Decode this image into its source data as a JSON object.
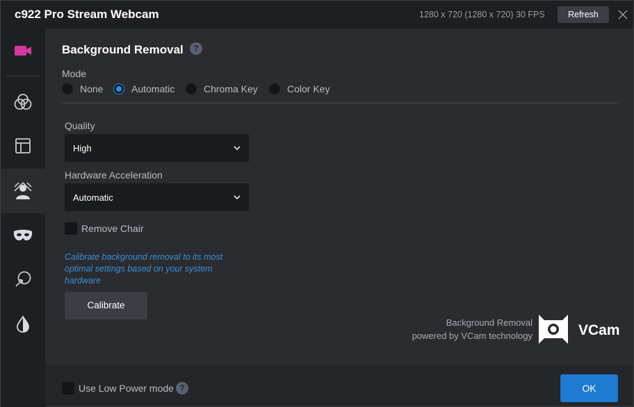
{
  "window": {
    "title": "c922 Pro Stream Webcam",
    "resolution_info": "1280 x 720 (1280 x 720) 30 FPS",
    "refresh_label": "Refresh"
  },
  "sidebar": {
    "items": [
      {
        "icon": "video-camera-icon",
        "color": "#d63aa0"
      },
      {
        "icon": "color-circles-icon"
      },
      {
        "icon": "layout-icon"
      },
      {
        "icon": "background-removal-icon",
        "active": true
      },
      {
        "icon": "mask-icon"
      },
      {
        "icon": "link-icon"
      },
      {
        "icon": "contrast-drop-icon"
      }
    ]
  },
  "main": {
    "section_title": "Background Removal",
    "mode_label": "Mode",
    "mode_options": [
      "None",
      "Automatic",
      "Chroma Key",
      "Color Key"
    ],
    "mode_selected": "Automatic",
    "quality_label": "Quality",
    "quality_value": "High",
    "hw_label": "Hardware Acceleration",
    "hw_value": "Automatic",
    "remove_chair_label": "Remove Chair",
    "calibrate_hint": "Calibrate background removal to its most optimal settings based on your system hardware",
    "calibrate_label": "Calibrate",
    "powered_line1": "Background Removal",
    "powered_line2": "powered by VCam technology",
    "vcam_label": "VCam"
  },
  "footer": {
    "low_power_label": "Use Low Power mode",
    "ok_label": "OK"
  },
  "colors": {
    "accent": "#1f7ad1",
    "link": "#3a8fd6",
    "camera_icon": "#d63aa0"
  }
}
